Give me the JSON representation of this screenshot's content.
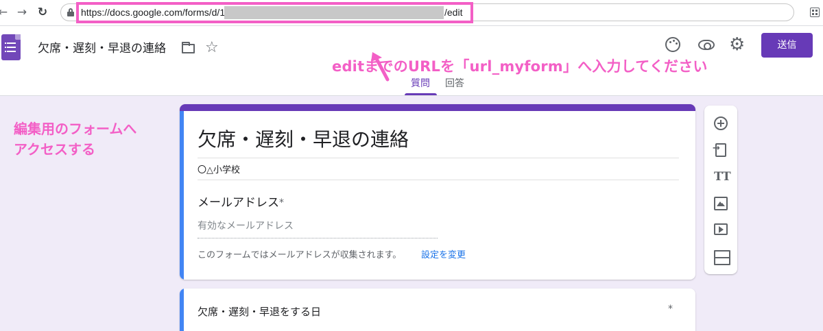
{
  "browser": {
    "url_prefix": "https://docs.google.com/forms/d/1",
    "url_suffix": "/edit",
    "icons": [
      "back-arrow-icon",
      "forward-arrow-icon",
      "reload-icon",
      "lock-icon",
      "extension-icon"
    ]
  },
  "header": {
    "doc_title": "欠席・遅刻・早退の連絡",
    "send_label": "送信",
    "tabs": [
      {
        "label": "質問",
        "active": true
      },
      {
        "label": "回答",
        "active": false
      }
    ],
    "icons": [
      "forms-logo-icon",
      "folder-icon",
      "star-icon",
      "palette-icon",
      "eye-icon",
      "gear-icon"
    ]
  },
  "annotations": {
    "url_note": "editまでのURLを「url_myform」へ入力してください",
    "left_note_line1": "編集用のフォームへ",
    "left_note_line2": "アクセスする",
    "color": "#f35fc6"
  },
  "form": {
    "title": "欠席・遅刻・早退の連絡",
    "description": "〇△小学校",
    "email_label": "メールアドレス",
    "required_mark": "*",
    "email_placeholder": "有効なメールアドレス",
    "email_note": "このフォームではメールアドレスが収集されます。",
    "change_link": "設定を変更",
    "question1_label": "欠席・遅刻・早退をする日"
  },
  "toolbar": {
    "text_glyph": "TT",
    "items": [
      "add-question-icon",
      "import-questions-icon",
      "add-title-icon",
      "add-image-icon",
      "add-video-icon",
      "add-section-icon"
    ]
  },
  "colors": {
    "accent": "#673ab7",
    "background": "#f0ebf8",
    "focus_bar": "#4285f4",
    "link": "#1a73e8"
  }
}
